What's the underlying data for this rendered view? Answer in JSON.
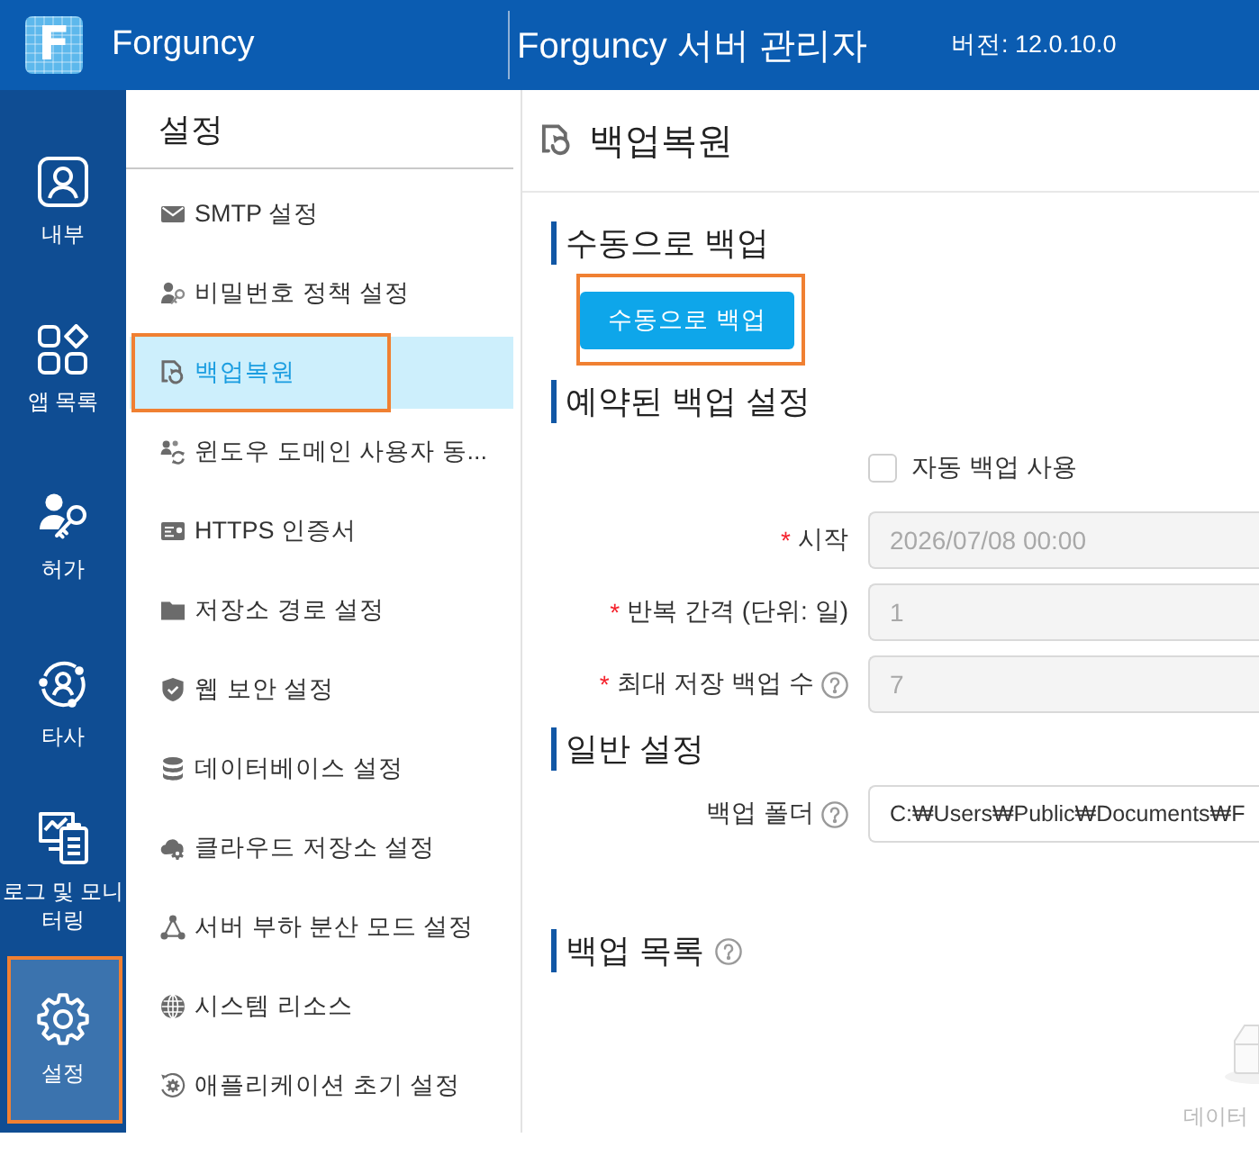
{
  "app_bar": {
    "logo_text": "F",
    "brand": "Forguncy",
    "title": "Forguncy 서버 관리자",
    "version": "버전: 12.0.10.0"
  },
  "nav": [
    {
      "label": "내부",
      "selected": false,
      "highlighted": false
    },
    {
      "label": "앱 목록",
      "selected": false,
      "highlighted": false
    },
    {
      "label": "허가",
      "selected": false,
      "highlighted": false
    },
    {
      "label": "타사",
      "selected": false,
      "highlighted": false
    },
    {
      "label": "로그 및 모니터링",
      "selected": false,
      "highlighted": false
    },
    {
      "label": "설정",
      "selected": true,
      "highlighted": true
    }
  ],
  "settings_menu": {
    "title": "설정",
    "items": [
      {
        "label": "SMTP 설정",
        "selected": false,
        "highlighted": false
      },
      {
        "label": "비밀번호 정책 설정",
        "selected": false,
        "highlighted": false
      },
      {
        "label": "백업복원",
        "selected": true,
        "highlighted": true
      },
      {
        "label": "윈도우 도메인 사용자 동...",
        "selected": false,
        "highlighted": false
      },
      {
        "label": "HTTPS 인증서",
        "selected": false,
        "highlighted": false
      },
      {
        "label": "저장소 경로 설정",
        "selected": false,
        "highlighted": false
      },
      {
        "label": "웹 보안 설정",
        "selected": false,
        "highlighted": false
      },
      {
        "label": "데이터베이스 설정",
        "selected": false,
        "highlighted": false
      },
      {
        "label": "클라우드 저장소 설정",
        "selected": false,
        "highlighted": false
      },
      {
        "label": "서버 부하 분산 모드 설정",
        "selected": false,
        "highlighted": false
      },
      {
        "label": "시스템 리소스",
        "selected": false,
        "highlighted": false
      },
      {
        "label": "애플리케이션 초기 설정",
        "selected": false,
        "highlighted": false
      }
    ]
  },
  "page": {
    "title": "백업복원"
  },
  "manual_backup": {
    "heading": "수동으로 백업",
    "button": {
      "label": "수동으로 백업",
      "highlighted": true
    }
  },
  "scheduled_backup": {
    "heading": "예약된 백업 설정",
    "auto_backup": {
      "label": "자동 백업 사용",
      "checked": false
    },
    "fields": [
      {
        "required_mark": "*",
        "label": "시작",
        "help": false,
        "value": "2026/07/08 00:00",
        "disabled": true
      },
      {
        "required_mark": "*",
        "label": "반복 간격 (단위: 일)",
        "help": false,
        "value": "1",
        "disabled": true
      },
      {
        "required_mark": "*",
        "label": "최대 저장 백업 수",
        "help": true,
        "value": "7",
        "disabled": true
      }
    ]
  },
  "general_settings": {
    "heading": "일반 설정",
    "fields": [
      {
        "label": "백업 폴더",
        "help": true,
        "value": "C:₩Users₩Public₩Documents₩F",
        "disabled": false
      }
    ]
  },
  "backup_list": {
    "heading": "백업 목록",
    "help": true,
    "empty_text": "데이터"
  }
}
